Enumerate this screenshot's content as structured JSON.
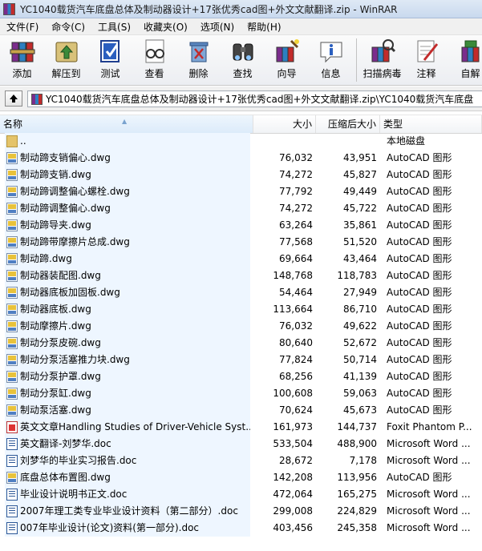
{
  "window": {
    "title": "YC1040载货汽车底盘总体及制动器设计+17张优秀cad图+外文文献翻译.zip - WinRAR"
  },
  "menu": [
    "文件(F)",
    "命令(C)",
    "工具(S)",
    "收藏夹(O)",
    "选项(N)",
    "帮助(H)"
  ],
  "toolbar": [
    {
      "label": "添加",
      "icon": "add-books-icon"
    },
    {
      "label": "解压到",
      "icon": "extract-icon"
    },
    {
      "label": "测试",
      "icon": "test-icon"
    },
    {
      "label": "查看",
      "icon": "view-glasses-icon"
    },
    {
      "label": "删除",
      "icon": "delete-icon"
    },
    {
      "label": "查找",
      "icon": "find-binoculars-icon"
    },
    {
      "label": "向导",
      "icon": "wizard-icon"
    },
    {
      "label": "信息",
      "icon": "info-icon"
    },
    {
      "label": "扫描病毒",
      "icon": "virus-scan-icon"
    },
    {
      "label": "注释",
      "icon": "comment-icon"
    },
    {
      "label": "自解",
      "icon": "sfx-icon"
    }
  ],
  "path": {
    "value": "YC1040载货汽车底盘总体及制动器设计+17张优秀cad图+外文文献翻译.zip\\YC1040载货汽车底盘"
  },
  "columns": {
    "name": "名称",
    "size": "大小",
    "packed": "压缩后大小",
    "type": "类型"
  },
  "files": [
    {
      "name": "..",
      "size": "",
      "packed": "",
      "type": "本地磁盘",
      "kind": "folder"
    },
    {
      "name": "制动蹄支销偏心.dwg",
      "size": "76,032",
      "packed": "43,951",
      "type": "AutoCAD 图形",
      "kind": "dwg"
    },
    {
      "name": "制动蹄支销.dwg",
      "size": "74,272",
      "packed": "45,827",
      "type": "AutoCAD 图形",
      "kind": "dwg"
    },
    {
      "name": "制动蹄调整偏心螺栓.dwg",
      "size": "77,792",
      "packed": "49,449",
      "type": "AutoCAD 图形",
      "kind": "dwg"
    },
    {
      "name": "制动蹄调整偏心.dwg",
      "size": "74,272",
      "packed": "45,722",
      "type": "AutoCAD 图形",
      "kind": "dwg"
    },
    {
      "name": "制动蹄导夹.dwg",
      "size": "63,264",
      "packed": "35,861",
      "type": "AutoCAD 图形",
      "kind": "dwg"
    },
    {
      "name": "制动蹄带摩擦片总成.dwg",
      "size": "77,568",
      "packed": "51,520",
      "type": "AutoCAD 图形",
      "kind": "dwg"
    },
    {
      "name": "制动蹄.dwg",
      "size": "69,664",
      "packed": "43,464",
      "type": "AutoCAD 图形",
      "kind": "dwg"
    },
    {
      "name": "制动器装配图.dwg",
      "size": "148,768",
      "packed": "118,783",
      "type": "AutoCAD 图形",
      "kind": "dwg"
    },
    {
      "name": "制动器底板加固板.dwg",
      "size": "54,464",
      "packed": "27,949",
      "type": "AutoCAD 图形",
      "kind": "dwg"
    },
    {
      "name": "制动器底板.dwg",
      "size": "113,664",
      "packed": "86,710",
      "type": "AutoCAD 图形",
      "kind": "dwg"
    },
    {
      "name": "制动摩擦片.dwg",
      "size": "76,032",
      "packed": "49,622",
      "type": "AutoCAD 图形",
      "kind": "dwg"
    },
    {
      "name": "制动分泵皮碗.dwg",
      "size": "80,640",
      "packed": "52,672",
      "type": "AutoCAD 图形",
      "kind": "dwg"
    },
    {
      "name": "制动分泵活塞推力块.dwg",
      "size": "77,824",
      "packed": "50,714",
      "type": "AutoCAD 图形",
      "kind": "dwg"
    },
    {
      "name": "制动分泵护罩.dwg",
      "size": "68,256",
      "packed": "41,139",
      "type": "AutoCAD 图形",
      "kind": "dwg"
    },
    {
      "name": "制动分泵缸.dwg",
      "size": "100,608",
      "packed": "59,063",
      "type": "AutoCAD 图形",
      "kind": "dwg"
    },
    {
      "name": "制动泵活塞.dwg",
      "size": "70,624",
      "packed": "45,673",
      "type": "AutoCAD 图形",
      "kind": "dwg"
    },
    {
      "name": "英文文章Handling Studies of Driver-Vehicle Syst...",
      "size": "161,973",
      "packed": "144,737",
      "type": "Foxit Phantom P...",
      "kind": "pdf"
    },
    {
      "name": "英文翻译-刘梦华.doc",
      "size": "533,504",
      "packed": "488,900",
      "type": "Microsoft Word ...",
      "kind": "doc"
    },
    {
      "name": "刘梦华的毕业实习报告.doc",
      "size": "28,672",
      "packed": "7,178",
      "type": "Microsoft Word ...",
      "kind": "doc"
    },
    {
      "name": "底盘总体布置图.dwg",
      "size": "142,208",
      "packed": "113,956",
      "type": "AutoCAD 图形",
      "kind": "dwg"
    },
    {
      "name": "毕业设计说明书正文.doc",
      "size": "472,064",
      "packed": "165,275",
      "type": "Microsoft Word ...",
      "kind": "doc"
    },
    {
      "name": "2007年理工类专业毕业设计资料（第二部分）.doc",
      "size": "299,008",
      "packed": "224,829",
      "type": "Microsoft Word ...",
      "kind": "doc"
    },
    {
      "name": "007年毕业设计(论文)资料(第一部分).doc",
      "size": "403,456",
      "packed": "245,358",
      "type": "Microsoft Word ...",
      "kind": "doc"
    }
  ]
}
